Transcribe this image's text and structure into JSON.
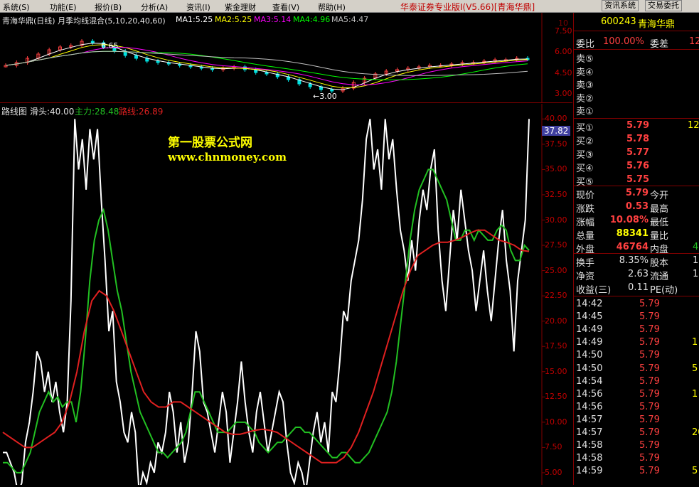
{
  "menubar": {
    "items": [
      "系统(S)",
      "功能(E)",
      "报价(B)",
      "分析(A)",
      "资讯(I)",
      "紫金理财",
      "查看(V)",
      "帮助(H)"
    ],
    "app_title": "华泰证券专业版I(V5.66)[青海华鼎]",
    "btn_news": "资讯系统",
    "btn_trade": "交易委托"
  },
  "kline": {
    "title": "青海华鼎(日线) 月季均线混合(5,10,20,40,60)",
    "ma": [
      {
        "label": "MA1:5.25",
        "color": "#ffffff"
      },
      {
        "label": "MA2:5.25",
        "color": "#ffff00"
      },
      {
        "label": "MA3:5.14",
        "color": "#ff00ff"
      },
      {
        "label": "MA4:4.96",
        "color": "#00ff00"
      },
      {
        "label": "MA5:4.47",
        "color": "#c0c0c0"
      }
    ],
    "y_ticks": [
      "7.50",
      "6.00",
      "4.50",
      "3.00"
    ],
    "marker_high": "6.65",
    "marker_low": "3.00",
    "corner_mark": "10"
  },
  "indicator": {
    "title": "路线图",
    "head_label": "滑头:40.00",
    "main_label": "主力:28.48",
    "route_label": "路线:26.89",
    "y_ticks": [
      "40.00",
      "37.50",
      "35.00",
      "32.50",
      "30.00",
      "27.50",
      "25.00",
      "22.50",
      "20.00",
      "17.50",
      "15.00",
      "12.50",
      "10.00",
      "7.50",
      "5.00"
    ],
    "current_value": "37.82",
    "ylim": [
      3.8,
      41.5
    ]
  },
  "watermark": {
    "line1": "第一股票公式网",
    "line2": "www.chnmoney.com"
  },
  "chart_data": {
    "type": "line",
    "title": "路线图",
    "ylim": [
      3.8,
      41.5
    ],
    "series": [
      {
        "name": "滑头",
        "color": "#ffffff",
        "values": [
          7,
          7,
          6,
          5,
          3,
          4,
          8,
          10,
          13,
          17,
          16,
          13,
          15,
          12,
          14,
          11,
          9,
          12,
          22,
          40,
          35,
          38,
          33,
          39,
          36,
          39,
          32,
          26,
          19,
          21,
          14,
          12,
          9,
          8,
          11,
          9,
          3,
          5,
          4,
          6,
          5,
          8,
          7,
          9,
          13,
          11,
          7,
          10,
          6,
          8,
          13,
          19,
          17,
          12,
          11,
          9,
          7,
          10,
          13,
          11,
          6,
          9,
          12,
          16,
          12,
          9,
          7,
          11,
          13,
          10,
          7,
          9,
          11,
          13,
          12,
          8,
          5,
          4,
          6,
          5,
          3,
          6,
          9,
          11,
          8,
          10,
          7,
          13,
          12,
          16,
          21,
          20,
          24,
          26,
          28,
          32,
          38,
          40,
          35,
          37,
          33,
          40,
          36,
          38,
          33,
          29,
          27,
          24,
          28,
          25,
          30,
          33,
          31,
          35,
          37,
          29,
          24,
          21,
          26,
          31,
          28,
          33,
          30,
          27,
          25,
          21,
          24,
          27,
          23,
          20,
          24,
          28,
          31,
          26,
          23,
          17,
          24,
          27,
          30,
          40
        ]
      },
      {
        "name": "主力",
        "color": "#22c022",
        "values": [
          6,
          6,
          5.5,
          5,
          5,
          6,
          7,
          9,
          11,
          12,
          13,
          12,
          12.5,
          11.5,
          12,
          12,
          10,
          13,
          18,
          24,
          28,
          30,
          31,
          29,
          26,
          23,
          21,
          18,
          15,
          13,
          11,
          10,
          9,
          8,
          7,
          7,
          6.5,
          7,
          7.5,
          8,
          9,
          11,
          13,
          13,
          12,
          11,
          10,
          9,
          9,
          9,
          9.5,
          10,
          10,
          10,
          9.5,
          9,
          8,
          7.5,
          7,
          7.5,
          8,
          8,
          8.5,
          9,
          9.5,
          9.5,
          9,
          9,
          8.5,
          8,
          7.5,
          7,
          6.5,
          6.5,
          7,
          7,
          6.5,
          6,
          6,
          6.5,
          7,
          8,
          9,
          10,
          11,
          13,
          16,
          20,
          24,
          28,
          31,
          33,
          34,
          35,
          35,
          34,
          33,
          32,
          30,
          28,
          28,
          29,
          29,
          28,
          29,
          28.5,
          28,
          28,
          29,
          29.5,
          29,
          27,
          26,
          26,
          27.5,
          27
        ]
      },
      {
        "name": "路线",
        "color": "#e02020",
        "values": [
          9,
          8.5,
          8,
          7.5,
          7.5,
          8,
          8.5,
          9,
          10,
          12,
          15,
          19,
          22,
          23,
          22.5,
          21,
          19,
          17,
          15,
          13,
          12,
          11.5,
          11.5,
          12,
          12,
          11.5,
          11,
          10.5,
          10,
          9.5,
          9,
          8.8,
          8.8,
          9,
          9.2,
          9.3,
          9.2,
          9,
          8.5,
          8,
          7.5,
          7,
          6.5,
          6,
          6,
          6,
          6.5,
          7.5,
          9,
          11,
          13,
          15.5,
          18,
          20.5,
          23,
          25,
          26.5,
          27,
          27.5,
          27.8,
          27.8,
          28,
          28.3,
          28.7,
          29,
          29,
          28.5,
          28,
          27.8,
          27.5,
          27,
          26.9
        ]
      }
    ]
  },
  "quote": {
    "code": "600243",
    "name": "青海华鼎",
    "weibi_label": "委比",
    "weibi_value": "100.00%",
    "weicha_label": "委差",
    "weicha_value": "12",
    "asks": [
      {
        "label": "卖⑤",
        "price": "",
        "vol": ""
      },
      {
        "label": "卖④",
        "price": "",
        "vol": ""
      },
      {
        "label": "卖③",
        "price": "",
        "vol": ""
      },
      {
        "label": "卖②",
        "price": "",
        "vol": ""
      },
      {
        "label": "卖①",
        "price": "",
        "vol": ""
      }
    ],
    "bids": [
      {
        "label": "买①",
        "price": "5.79",
        "vol": "12"
      },
      {
        "label": "买②",
        "price": "5.78",
        "vol": ""
      },
      {
        "label": "买③",
        "price": "5.77",
        "vol": ""
      },
      {
        "label": "买④",
        "price": "5.76",
        "vol": ""
      },
      {
        "label": "买⑤",
        "price": "5.75",
        "vol": ""
      }
    ],
    "stats": [
      {
        "l1": "现价",
        "v1": "5.79",
        "c1": "#ff4040",
        "l2": "今开",
        "v2": ""
      },
      {
        "l1": "涨跌",
        "v1": "0.53",
        "c1": "#ff4040",
        "l2": "最高",
        "v2": ""
      },
      {
        "l1": "涨幅",
        "v1": "10.08%",
        "c1": "#ff4040",
        "l2": "最低",
        "v2": ""
      },
      {
        "l1": "总量",
        "v1": "88341",
        "c1": "#ffff00",
        "l2": "量比",
        "v2": ""
      },
      {
        "l1": "外盘",
        "v1": "46764",
        "c1": "#ff4040",
        "l2": "内盘",
        "v2": "4"
      }
    ],
    "stats2": [
      {
        "l1": "换手",
        "v1": "8.35%",
        "l2": "股本",
        "v2": "1."
      },
      {
        "l1": "净资",
        "v1": "2.63",
        "l2": "流通",
        "v2": "1."
      },
      {
        "l1": "收益(三)",
        "v1": "0.11",
        "l2": "PE(动)",
        "v2": ""
      }
    ],
    "ticks": [
      {
        "time": "14:42",
        "price": "5.79",
        "vol": ""
      },
      {
        "time": "14:45",
        "price": "5.79",
        "vol": ""
      },
      {
        "time": "14:49",
        "price": "5.79",
        "vol": ""
      },
      {
        "time": "14:49",
        "price": "5.79",
        "vol": "1"
      },
      {
        "time": "14:50",
        "price": "5.79",
        "vol": ""
      },
      {
        "time": "14:50",
        "price": "5.79",
        "vol": "5"
      },
      {
        "time": "14:54",
        "price": "5.79",
        "vol": ""
      },
      {
        "time": "14:56",
        "price": "5.79",
        "vol": "1"
      },
      {
        "time": "14:56",
        "price": "5.79",
        "vol": ""
      },
      {
        "time": "14:57",
        "price": "5.79",
        "vol": ""
      },
      {
        "time": "14:57",
        "price": "5.79",
        "vol": "20"
      },
      {
        "time": "14:58",
        "price": "5.79",
        "vol": ""
      },
      {
        "time": "14:58",
        "price": "5.79",
        "vol": ""
      },
      {
        "time": "14:59",
        "price": "5.79",
        "vol": "5"
      }
    ]
  }
}
